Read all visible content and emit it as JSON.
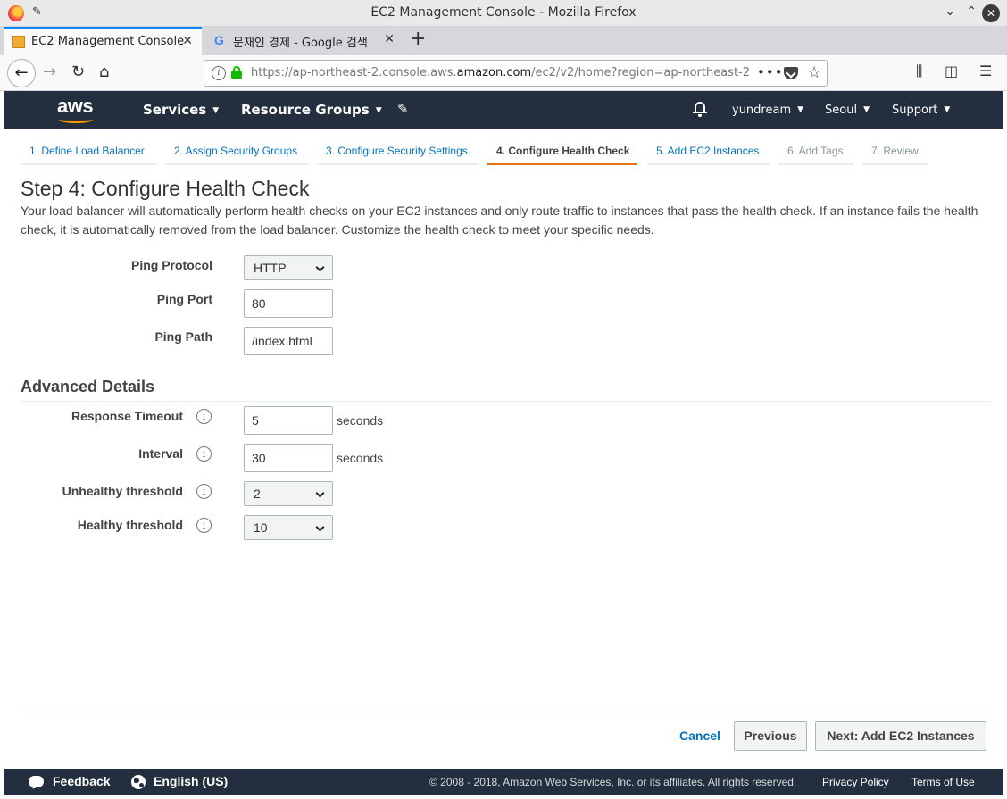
{
  "window": {
    "title": "EC2 Management Console - Mozilla Firefox"
  },
  "tabs": [
    {
      "label": "EC2 Management Console",
      "icon": "aws-box-icon"
    },
    {
      "label": "문재인 경제 - Google 검색",
      "icon": "google-icon"
    }
  ],
  "browser": {
    "url_prefix": "https://ap-northeast-2.console.aws.",
    "url_domain": "amazon.com",
    "url_suffix": "/ec2/v2/home?region=ap-northeast-2"
  },
  "aws_header": {
    "logo": "aws",
    "services": "Services",
    "resource_groups": "Resource Groups",
    "user": "yundream",
    "region": "Seoul",
    "support": "Support"
  },
  "steps": [
    {
      "label": "1. Define Load Balancer",
      "state": "link"
    },
    {
      "label": "2. Assign Security Groups",
      "state": "link"
    },
    {
      "label": "3. Configure Security Settings",
      "state": "link"
    },
    {
      "label": "4. Configure Health Check",
      "state": "active"
    },
    {
      "label": "5. Add EC2 Instances",
      "state": "link"
    },
    {
      "label": "6. Add Tags",
      "state": "disabled"
    },
    {
      "label": "7. Review",
      "state": "disabled"
    }
  ],
  "page": {
    "title": "Step 4: Configure Health Check",
    "description": "Your load balancer will automatically perform health checks on your EC2 instances and only route traffic to instances that pass the health check. If an instance fails the health check, it is automatically removed from the load balancer. Customize the health check to meet your specific needs."
  },
  "form": {
    "ping_protocol": {
      "label": "Ping Protocol",
      "value": "HTTP"
    },
    "ping_port": {
      "label": "Ping Port",
      "value": "80"
    },
    "ping_path": {
      "label": "Ping Path",
      "value": "/index.html"
    }
  },
  "advanced": {
    "title": "Advanced Details",
    "response_timeout": {
      "label": "Response Timeout",
      "value": "5",
      "unit": "seconds"
    },
    "interval": {
      "label": "Interval",
      "value": "30",
      "unit": "seconds"
    },
    "unhealthy_threshold": {
      "label": "Unhealthy threshold",
      "value": "2"
    },
    "healthy_threshold": {
      "label": "Healthy threshold",
      "value": "10"
    }
  },
  "actions": {
    "cancel": "Cancel",
    "previous": "Previous",
    "next": "Next: Add EC2 Instances"
  },
  "footer": {
    "feedback": "Feedback",
    "language": "English (US)",
    "copyright": "© 2008 - 2018, Amazon Web Services, Inc. or its affiliates. All rights reserved.",
    "privacy": "Privacy Policy",
    "terms": "Terms of Use"
  },
  "colors": {
    "aws_nav": "#232f3e",
    "aws_orange": "#ec7211",
    "link_blue": "#0073bb",
    "firefox_tab_accent": "#0a84ff"
  }
}
